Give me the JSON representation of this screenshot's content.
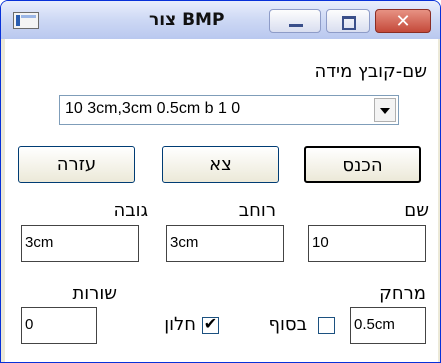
{
  "window": {
    "title": "BMP צור"
  },
  "titlebar": {
    "close_glyph": "✕"
  },
  "filename": {
    "label": "שם-קובץ מידה",
    "value": "10 3cm,3cm 0.5cm b 1 0"
  },
  "buttons": {
    "ok": "הכנס",
    "exit": "צא",
    "help": "עזרה"
  },
  "fields": {
    "name": {
      "label": "שם",
      "value": "10"
    },
    "width": {
      "label": "רוחב",
      "value": "3cm"
    },
    "height": {
      "label": "גובה",
      "value": "3cm"
    },
    "spacing": {
      "label": "מרחק",
      "value": "0.5cm"
    },
    "rows": {
      "label": "שורות",
      "value": "0"
    }
  },
  "checkboxes": {
    "end": {
      "label": "בסוף",
      "checked": false
    },
    "window": {
      "label": "חלון",
      "checked": true,
      "mark": "✔"
    }
  }
}
